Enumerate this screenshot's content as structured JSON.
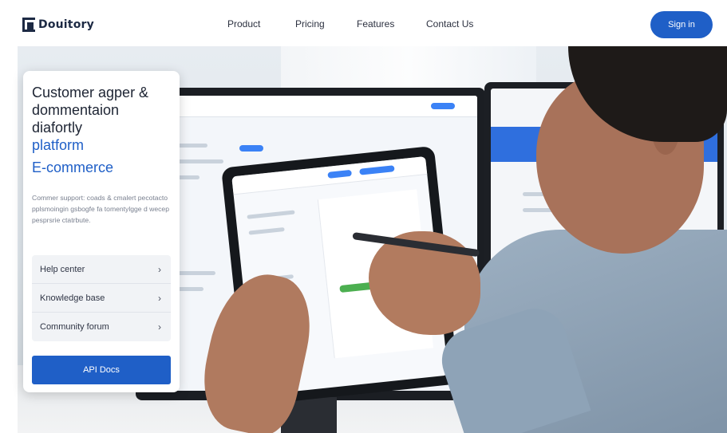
{
  "header": {
    "brand": "Douitory",
    "nav": [
      "Product",
      "Pricing",
      "Features",
      "Contact Us"
    ],
    "signin_label": "Sign in"
  },
  "card": {
    "title_lines": [
      "Customer agper &",
      "dommentaion",
      "diafortly",
      "platform"
    ],
    "subtitle": "E-commerce",
    "description": "Commer support: coads & cmalert pecotacto pplsmoingin gsbogfe fa tomentylgge d wecep pesprsrie ctatrbute.",
    "links": [
      {
        "label": "Help center"
      },
      {
        "label": "Knowledge base"
      },
      {
        "label": "Community forum"
      }
    ],
    "chevron": "›",
    "api_button": "API Docs"
  },
  "colors": {
    "accent": "#1f5fc7",
    "brand_dark": "#1d2a44",
    "card_bg": "#ffffff",
    "link_bg": "#f1f3f6"
  },
  "icons": {
    "logo": "brand-logo-mark",
    "chevron": "chevron-right-icon"
  }
}
